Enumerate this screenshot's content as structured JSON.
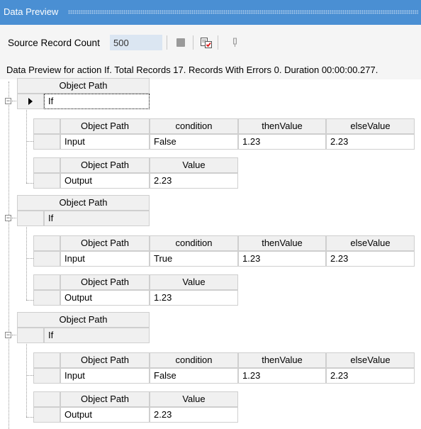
{
  "window": {
    "title": "Data Preview"
  },
  "toolbar": {
    "source_label": "Source Record Count",
    "source_count": "500"
  },
  "status": {
    "text": "Data Preview for action If. Total Records 17. Records With Errors 0. Duration 00:00:00.277."
  },
  "groups": [
    {
      "header": "Object Path",
      "row_label": "If",
      "input_table": {
        "headers": [
          "Object Path",
          "condition",
          "thenValue",
          "elseValue"
        ],
        "row": [
          "Input",
          "False",
          "1.23",
          "2.23"
        ]
      },
      "output_table": {
        "headers": [
          "Object Path",
          "Value"
        ],
        "row": [
          "Output",
          "2.23"
        ]
      }
    },
    {
      "header": "Object Path",
      "row_label": "If",
      "input_table": {
        "headers": [
          "Object Path",
          "condition",
          "thenValue",
          "elseValue"
        ],
        "row": [
          "Input",
          "True",
          "1.23",
          "2.23"
        ]
      },
      "output_table": {
        "headers": [
          "Object Path",
          "Value"
        ],
        "row": [
          "Output",
          "1.23"
        ]
      }
    },
    {
      "header": "Object Path",
      "row_label": "If",
      "input_table": {
        "headers": [
          "Object Path",
          "condition",
          "thenValue",
          "elseValue"
        ],
        "row": [
          "Input",
          "False",
          "1.23",
          "2.23"
        ]
      },
      "output_table": {
        "headers": [
          "Object Path",
          "Value"
        ],
        "row": [
          "Output",
          "2.23"
        ]
      }
    }
  ]
}
